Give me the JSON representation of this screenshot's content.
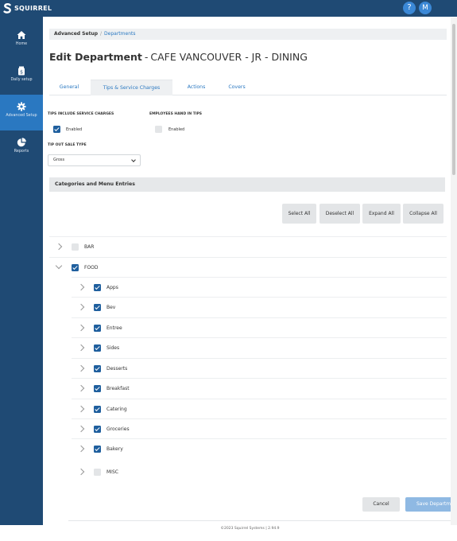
{
  "app": {
    "brand": "SQUIRREL"
  },
  "header": {
    "help_label": "?",
    "user_initial": "M"
  },
  "sidebar": {
    "items": [
      {
        "label": "Home",
        "icon": "home-icon",
        "active": false
      },
      {
        "label": "Daily setup",
        "icon": "daily-setup-icon",
        "active": false
      },
      {
        "label": "Advanced Setup",
        "icon": "gear-icon",
        "active": true
      },
      {
        "label": "Reports",
        "icon": "pie-chart-icon",
        "active": false
      }
    ]
  },
  "breadcrumb": {
    "root": "Advanced Setup",
    "separator": "/",
    "current": "Departments"
  },
  "page": {
    "title_strong": "Edit Department",
    "title_sep": "-",
    "title_name": "CAFE VANCOUVER - JR - DINING"
  },
  "tabs": [
    {
      "label": "General",
      "active": false
    },
    {
      "label": "Tips & Service Charges",
      "active": true
    },
    {
      "label": "Actions",
      "active": false
    },
    {
      "label": "Covers",
      "active": false
    }
  ],
  "form": {
    "tips_include_label": "TIPS INCLUDE SERVICE CHARGES",
    "tips_include_value": "Enabled",
    "tips_include_checked": true,
    "hand_in_label": "EMPLOYEES HAND IN TIPS",
    "hand_in_value": "Enabled",
    "hand_in_checked": false,
    "tip_out_label": "TIP OUT SALE TYPE",
    "tip_out_value": "Gross"
  },
  "categories": {
    "title": "Categories and Menu Entries",
    "buttons": {
      "select_all": "Select All",
      "deselect_all": "Deselect All",
      "expand_all": "Expand All",
      "collapse_all": "Collapse All"
    },
    "tree": [
      {
        "label": "BAR",
        "level": 0,
        "expanded": false,
        "checked": false
      },
      {
        "label": "FOOD",
        "level": 0,
        "expanded": true,
        "checked": true
      },
      {
        "label": "Apps",
        "level": 1,
        "expanded": false,
        "checked": true
      },
      {
        "label": "Bev",
        "level": 1,
        "expanded": false,
        "checked": true
      },
      {
        "label": "Entree",
        "level": 1,
        "expanded": false,
        "checked": true
      },
      {
        "label": "Sides",
        "level": 1,
        "expanded": false,
        "checked": true
      },
      {
        "label": "Desserts",
        "level": 1,
        "expanded": false,
        "checked": true
      },
      {
        "label": "Breakfast",
        "level": 1,
        "expanded": false,
        "checked": true
      },
      {
        "label": "Catering",
        "level": 1,
        "expanded": false,
        "checked": true
      },
      {
        "label": "Groceries",
        "level": 1,
        "expanded": false,
        "checked": true
      },
      {
        "label": "Bakery",
        "level": 1,
        "expanded": false,
        "checked": true
      },
      {
        "label": "MISC",
        "level": 1,
        "expanded": false,
        "checked": false
      }
    ]
  },
  "actions": {
    "cancel": "Cancel",
    "save": "Save Department"
  },
  "footer": {
    "text": "©2023 Squirrel Systems | 2.94.9"
  },
  "colors": {
    "navy": "#1f4a74",
    "accent": "#2a78c1",
    "checkbox": "#1f5f9e"
  }
}
